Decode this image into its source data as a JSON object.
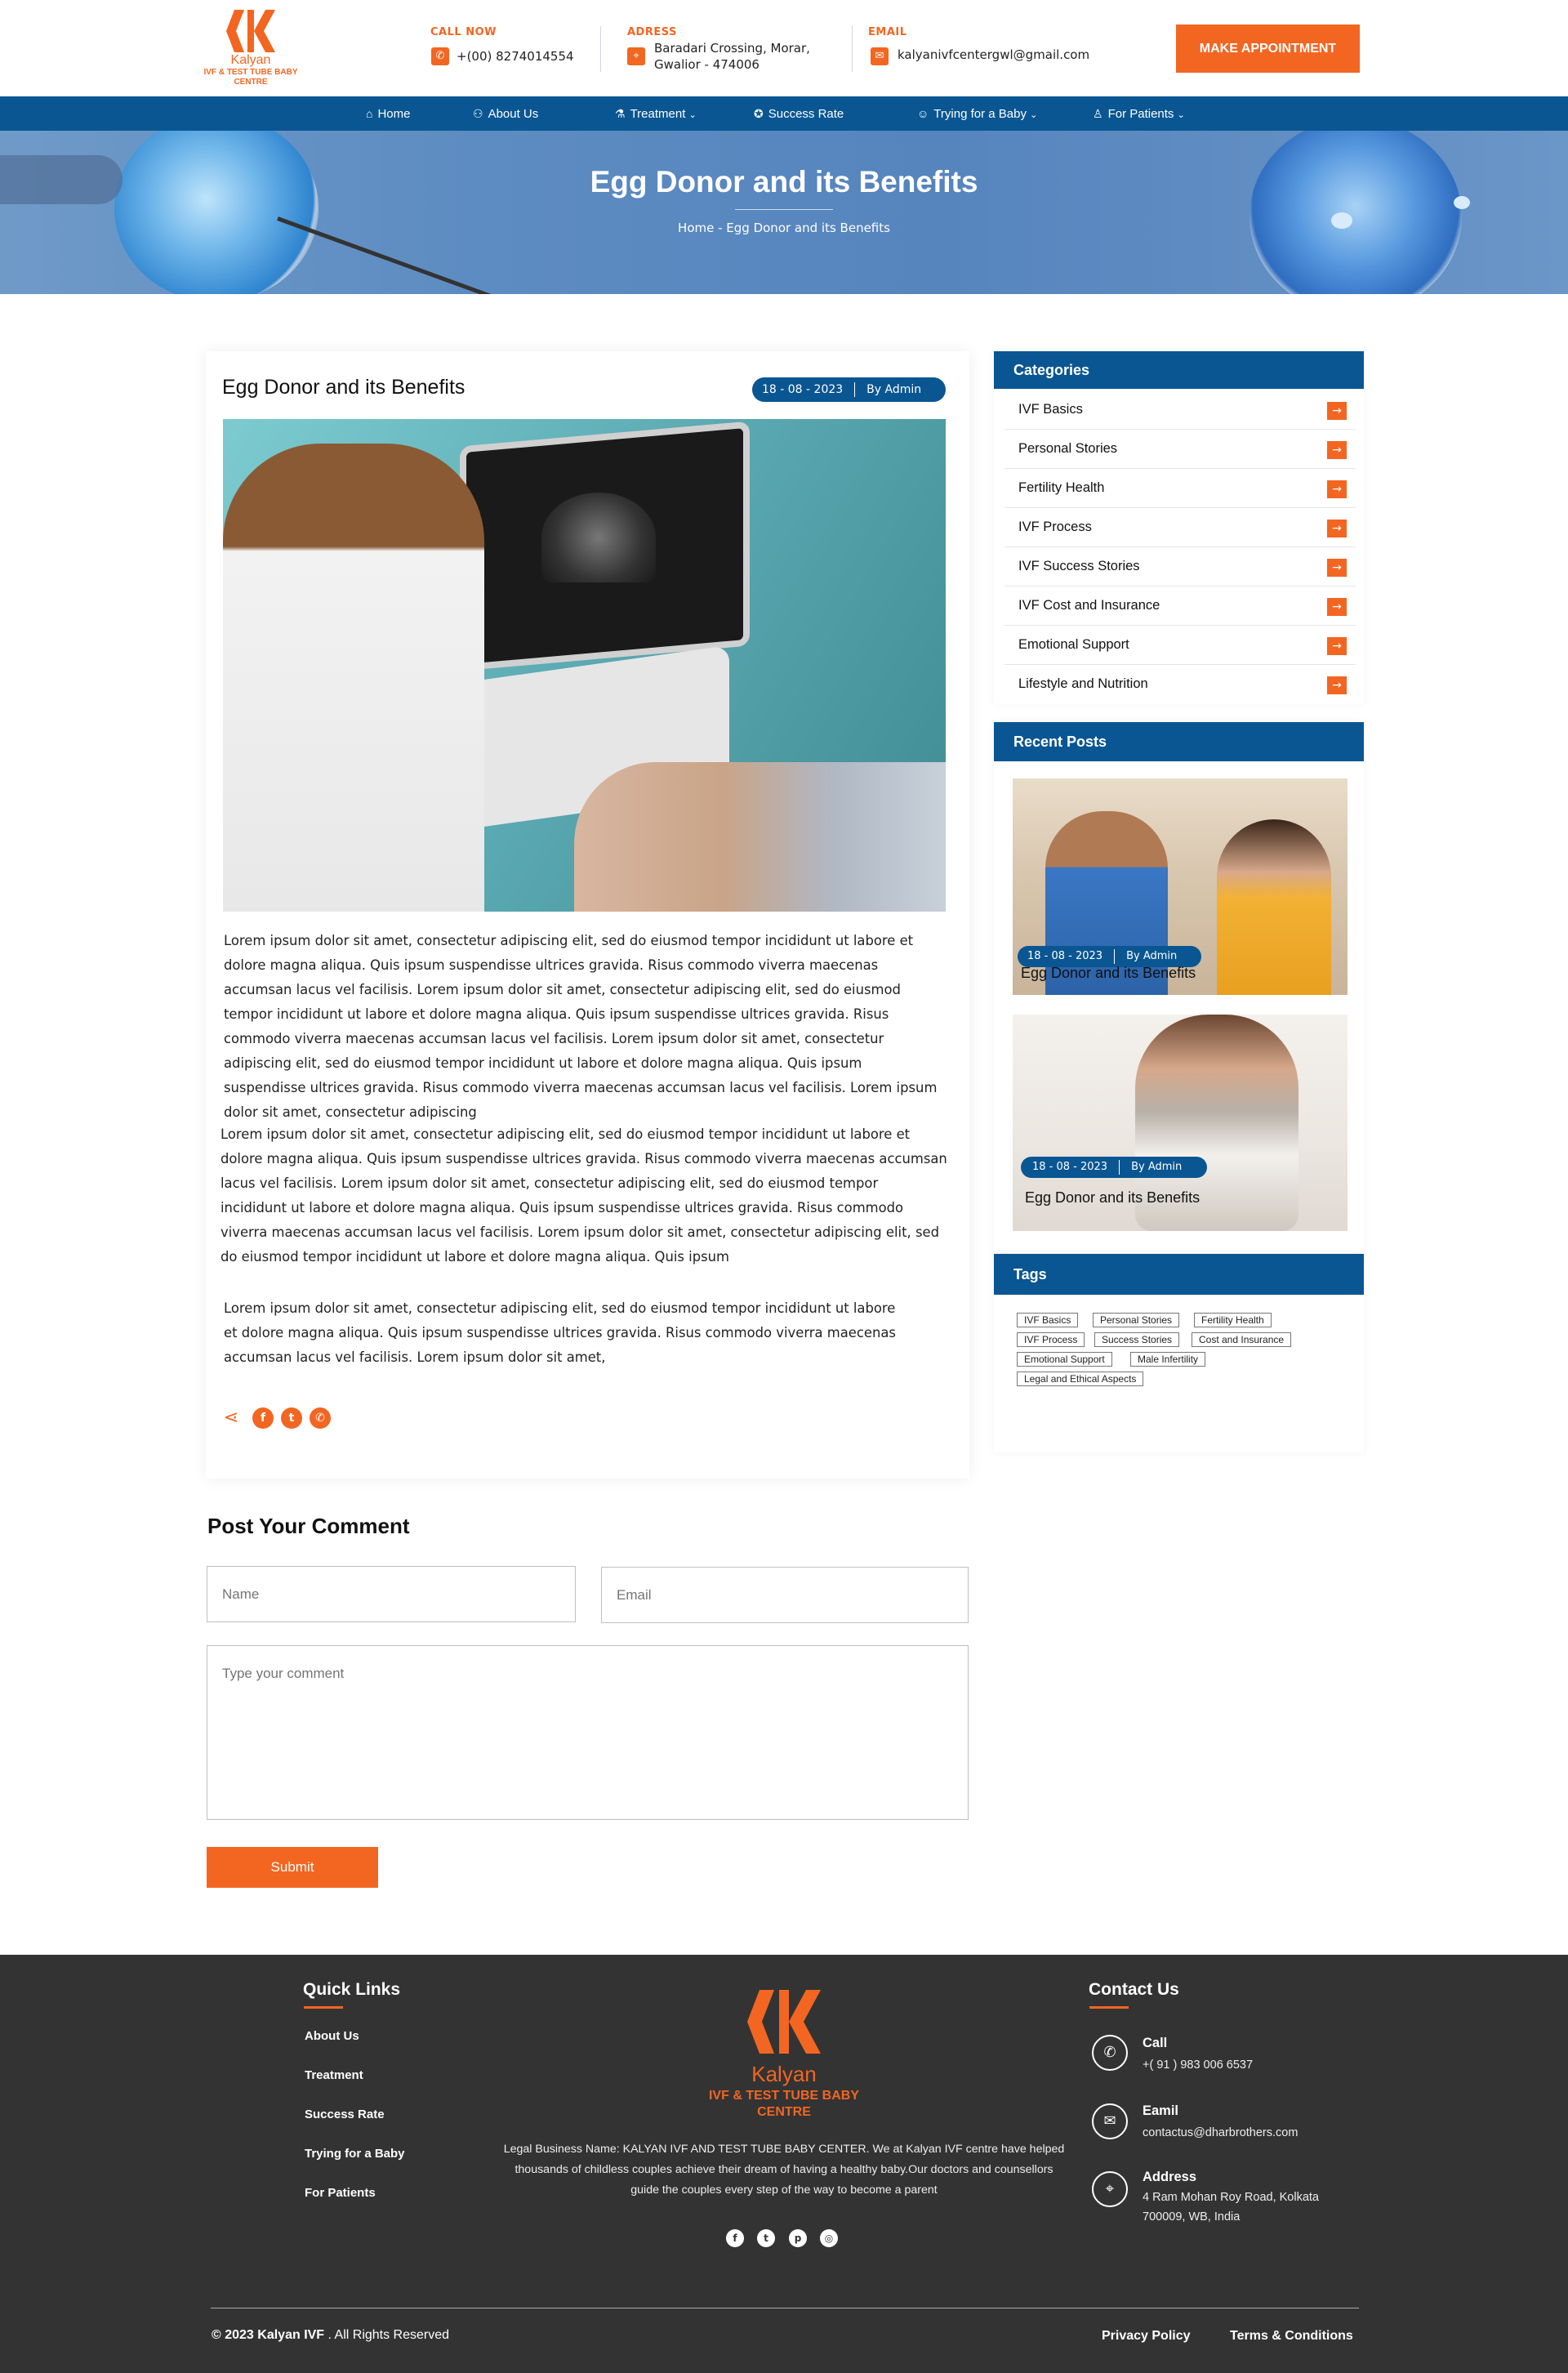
{
  "header": {
    "logo_name": "Kalyan",
    "logo_sub": "IVF & TEST TUBE BABY CENTRE",
    "call_label": "CALL NOW",
    "call_value": "+(00) 8274014554",
    "address_label": "ADRESS",
    "address_line1": "Baradari Crossing, Morar,",
    "address_line2": "Gwalior - 474006",
    "email_label": "EMAIL",
    "email_value": "kalyanivfcentergwl@gmail.com",
    "appointment_button": "MAKE APPOINTMENT"
  },
  "nav": {
    "items": [
      {
        "label": "Home",
        "icon": "home-icon"
      },
      {
        "label": "About Us",
        "icon": "people-icon"
      },
      {
        "label": "Treatment",
        "icon": "microscope-icon",
        "dropdown": true
      },
      {
        "label": "Success Rate",
        "icon": "award-icon"
      },
      {
        "label": "Trying for a Baby",
        "icon": "baby-icon",
        "dropdown": true
      },
      {
        "label": "For Patients",
        "icon": "patient-icon",
        "dropdown": true
      }
    ]
  },
  "banner": {
    "title": "Egg Donor and its Benefits",
    "breadcrumb": "Home - Egg Donor and its Benefits"
  },
  "article": {
    "title": "Egg Donor and its Benefits",
    "date": "18 - 08 - 2023",
    "author": "By Admin",
    "paragraphs": [
      "Lorem ipsum dolor sit amet, consectetur adipiscing elit, sed do eiusmod tempor incididunt ut labore et dolore magna aliqua. Quis ipsum suspendisse ultrices gravida. Risus commodo viverra maecenas accumsan lacus vel facilisis. Lorem ipsum dolor sit amet, consectetur adipiscing elit, sed do eiusmod tempor incididunt ut labore et dolore magna aliqua. Quis ipsum suspendisse ultrices gravida. Risus commodo viverra maecenas accumsan lacus vel facilisis. Lorem ipsum dolor sit amet, consectetur adipiscing elit, sed do eiusmod tempor incididunt ut labore et dolore magna aliqua. Quis ipsum suspendisse ultrices gravida. Risus commodo viverra maecenas accumsan lacus vel facilisis. Lorem ipsum dolor sit amet, consectetur adipiscing",
      "Lorem ipsum dolor sit amet, consectetur adipiscing elit, sed do eiusmod tempor incididunt ut labore et dolore magna aliqua. Quis ipsum suspendisse ultrices gravida. Risus commodo viverra maecenas accumsan lacus vel facilisis. Lorem ipsum dolor sit amet, consectetur adipiscing elit, sed do eiusmod tempor incididunt ut labore et dolore magna aliqua. Quis ipsum suspendisse ultrices gravida. Risus commodo viverra maecenas accumsan lacus vel facilisis. Lorem ipsum dolor sit amet, consectetur adipiscing elit, sed do eiusmod tempor incididunt ut labore et dolore magna aliqua. Quis ipsum",
      "Lorem ipsum dolor sit amet, consectetur adipiscing elit, sed do eiusmod tempor incididunt ut labore et dolore magna aliqua. Quis ipsum suspendisse ultrices gravida. Risus commodo viverra maecenas accumsan lacus vel facilisis. Lorem ipsum dolor sit amet,"
    ],
    "share_icons": [
      "share-icon",
      "facebook-icon",
      "twitter-icon",
      "whatsapp-icon"
    ]
  },
  "comment": {
    "heading": "Post Your Comment",
    "name_placeholder": "Name",
    "email_placeholder": "Email",
    "comment_placeholder": "Type your comment",
    "submit_label": "Submit"
  },
  "sidebar": {
    "categories_title": "Categories",
    "categories": [
      "IVF Basics",
      "Personal Stories",
      "Fertility Health",
      "IVF Process",
      "IVF Success Stories",
      "IVF Cost and Insurance",
      "Emotional Support",
      "Lifestyle and Nutrition"
    ],
    "recent_title": "Recent Posts",
    "recent_posts": [
      {
        "date": "18 - 08 - 2023",
        "author": "By Admin",
        "title": "Egg Donor and its Benefits"
      },
      {
        "date": "18 - 08 - 2023",
        "author": "By Admin",
        "title": "Egg Donor and its Benefits"
      }
    ],
    "tags_title": "Tags",
    "tags": [
      "IVF Basics",
      "Personal Stories",
      "Fertility Health",
      "IVF Process",
      "Success Stories",
      "Cost and Insurance",
      "Emotional Support",
      "Male Infertility",
      "Legal and Ethical Aspects"
    ]
  },
  "footer": {
    "quick_links_title": "Quick Links",
    "quick_links": [
      "About Us",
      "Treatment",
      "Success Rate",
      "Trying for a Baby",
      "For Patients"
    ],
    "logo_name": "Kalyan",
    "logo_sub1": "IVF & TEST TUBE BABY",
    "logo_sub2": "CENTRE",
    "about_text": "Legal Business Name: KALYAN IVF AND TEST TUBE BABY CENTER. We at Kalyan IVF centre have helped thousands of childless couples achieve their dream of having a healthy baby.Our doctors and counsellors guide the couples every step of the way to become a parent",
    "social_icons": [
      "facebook-icon",
      "twitter-icon",
      "pinterest-icon",
      "instagram-icon"
    ],
    "contact_title": "Contact Us",
    "contacts": [
      {
        "title": "Call",
        "value": "+( 91 ) 983 006 6537",
        "icon": "phone-icon"
      },
      {
        "title": "Eamil",
        "value": "contactus@dharbrothers.com",
        "icon": "mail-icon"
      },
      {
        "title": "Address",
        "value": "4 Ram Mohan Roy Road, Kolkata 700009, WB, India",
        "icon": "location-icon"
      }
    ],
    "copyright_brand": "© 2023 Kalyan IVF",
    "copyright_rest": " . All Rights Reserved",
    "privacy": "Privacy Policy",
    "terms": "Terms & Conditions"
  },
  "colors": {
    "accent": "#f26622",
    "brand_blue": "#0a5692",
    "footer_bg": "#333333"
  }
}
